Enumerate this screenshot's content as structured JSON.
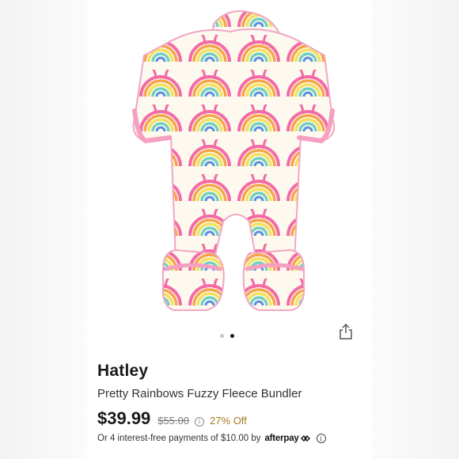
{
  "product": {
    "image_alt": "Pretty Rainbows Fuzzy Fleece Bundler back view",
    "brand": "Hatley",
    "title": "Pretty Rainbows Fuzzy Fleece Bundler",
    "price": "$39.99",
    "original_price": "$55.00",
    "discount": "27% Off"
  },
  "carousel": {
    "total": 2,
    "active_index": 1
  },
  "payment": {
    "installment_text": "Or 4 interest-free payments of $10.00 by",
    "provider": "afterpay"
  },
  "icons": {
    "share": "share-icon",
    "price_info": "info-icon",
    "installment_info": "info-icon"
  },
  "colors": {
    "price": "#1a1a1a",
    "discount": "#a87a1f",
    "dot_active": "#1a1a1a",
    "dot_inactive": "#c4c4c4"
  }
}
